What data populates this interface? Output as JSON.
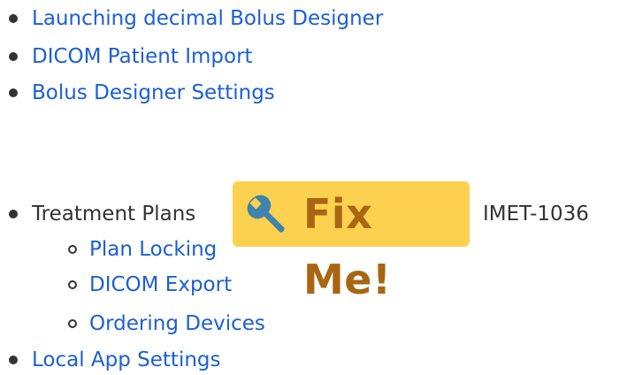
{
  "list": {
    "items": [
      {
        "label": "Launching decimal Bolus Designer"
      },
      {
        "label": "DICOM Patient Import"
      },
      {
        "label": "Bolus Designer Settings"
      },
      {
        "label": "Treatment Plans",
        "fixme_label": "Fix Me!",
        "ticket": "IMET-1036",
        "children": [
          {
            "label": "Plan Locking"
          },
          {
            "label": "DICOM Export"
          },
          {
            "label": "Ordering Devices"
          }
        ]
      },
      {
        "label": "Local App Settings"
      }
    ]
  },
  "colors": {
    "link": "#1c5fd4",
    "text": "#333333",
    "fixme_background": "#fcd14f",
    "fixme_text": "#a86613"
  }
}
